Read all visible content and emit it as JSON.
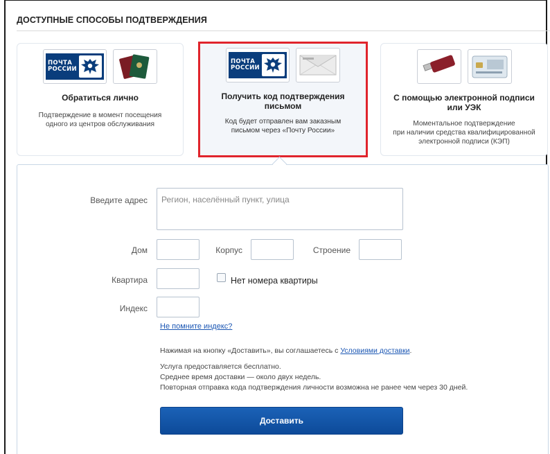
{
  "section": {
    "title": "ДОСТУПНЫЕ СПОСОБЫ ПОДТВЕРЖДЕНИЯ"
  },
  "cards": [
    {
      "title": "Обратиться лично",
      "desc_line1": "Подтверждение в момент посещения",
      "desc_line2": "одного из центров обслуживания",
      "logo_text_line1": "ПОЧТА",
      "logo_text_line2": "РОССИИ",
      "icons": [
        "pochta-rossii-logo",
        "passport-icon"
      ]
    },
    {
      "title_line1": "Получить код подтверждения",
      "title_line2": "письмом",
      "desc_line1": "Код будет отправлен вам заказным",
      "desc_line2": "письмом через «Почту России»",
      "logo_text_line1": "ПОЧТА",
      "logo_text_line2": "РОССИИ",
      "icons": [
        "pochta-rossii-logo",
        "envelope-icon"
      ],
      "selected": true,
      "highlight_color": "#e0242c"
    },
    {
      "title_line1": "С помощью электронной подписи",
      "title_line2": "или УЭК",
      "desc_line1": "Моментальное подтверждение",
      "desc_line2": "при наличии средства квалифицированной",
      "desc_line3": "электронной подписи (КЭП)",
      "icons": [
        "usb-token-icon",
        "uek-card-icon"
      ]
    }
  ],
  "form": {
    "address_label": "Введите адрес",
    "address_placeholder": "Регион, населённый пункт, улица",
    "house_label": "Дом",
    "building_label": "Корпус",
    "structure_label": "Строение",
    "apartment_label": "Квартира",
    "no_apartment_label": "Нет номера квартиры",
    "index_label": "Индекс",
    "forgot_index_link": "Не помните индекс?",
    "agree_text": "Нажимая на кнопку «Доставить», вы соглашаетесь с ",
    "terms_link": "Условиями доставки",
    "agree_end": ".",
    "info_line1": "Услуга предоставляется бесплатно.",
    "info_line2": "Среднее время доставки — около двух недель.",
    "info_line3": "Повторная отправка кода подтверждения личности возможна не ранее чем через 30 дней.",
    "submit_label": "Доставить"
  },
  "colors": {
    "accent": "#0d4a99",
    "selected_border": "#e0242c",
    "link": "#1a56b3"
  }
}
